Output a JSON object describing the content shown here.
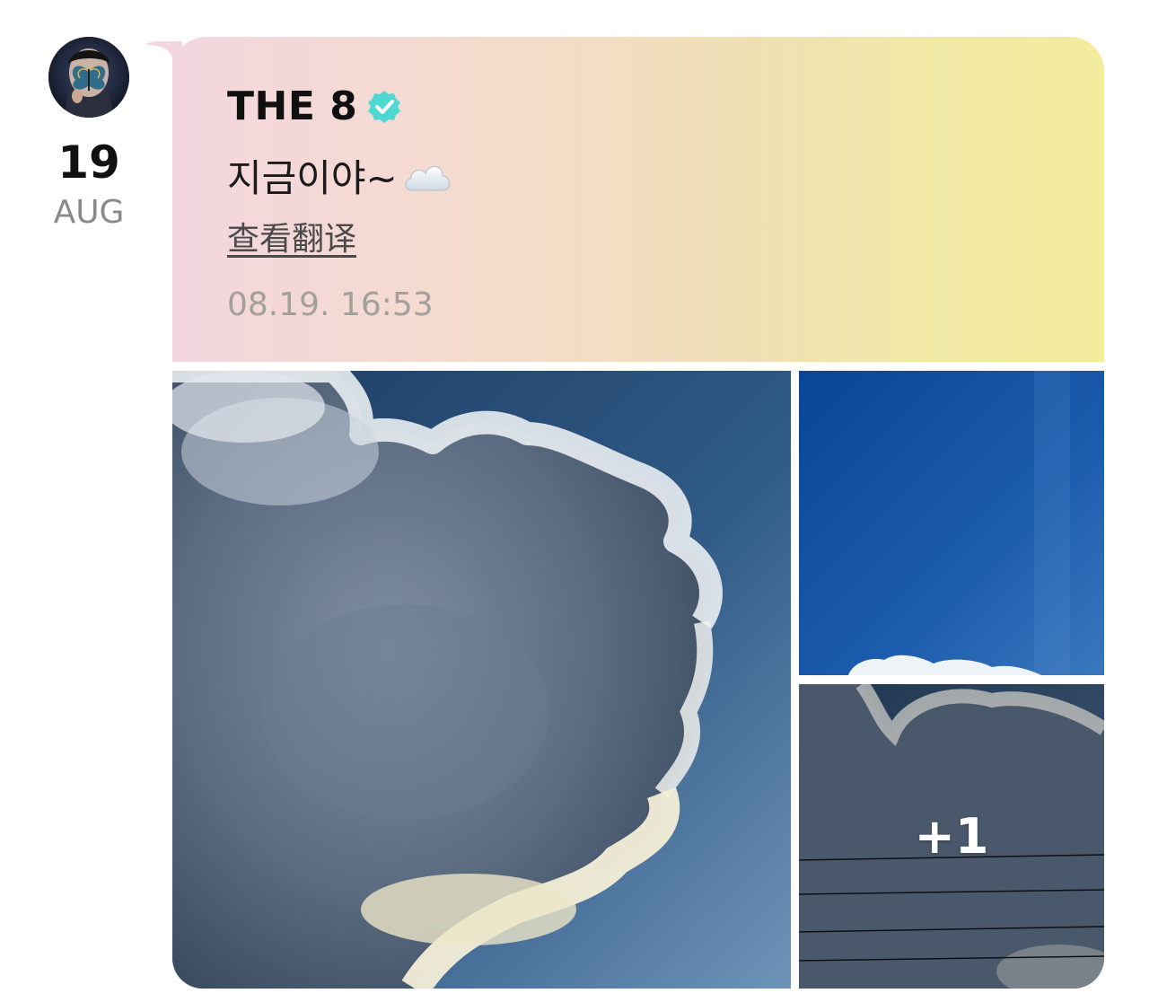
{
  "date": {
    "day": "19",
    "month": "AUG"
  },
  "post": {
    "author": "THE 8",
    "verified_icon": "verified-badge-icon",
    "text": "지금이야~",
    "emoji": "cloud-emoji-icon",
    "translate_link": "查看翻译",
    "timestamp": "08.19. 16:53"
  },
  "photos": {
    "more_count": "+1"
  },
  "colors": {
    "bubble_gradient_start": "#f4d6df",
    "bubble_gradient_end": "#f3ec9c",
    "verified": "#4fd8d2",
    "timestamp": "#a2a09a"
  }
}
